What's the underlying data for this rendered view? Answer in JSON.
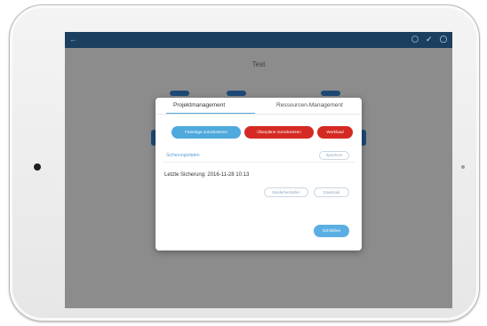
{
  "app": {
    "back_label": "←",
    "page_title": "Test"
  },
  "modal": {
    "tabs": [
      {
        "label": "Projektmanagement",
        "active": true
      },
      {
        "label": "Ressourcen-Management",
        "active": false
      }
    ],
    "actions": {
      "reset_blue": "Feiertage zurücksetzen",
      "reset_red": "Überpläne zurücksetzen",
      "workload": "Workload"
    },
    "section_label": "Sicherungsdaten",
    "save_label": "Speichern",
    "last_backup": "Letzte Sicherung: 2016-11-28 10:13",
    "restore_label": "Wiederherstellen",
    "download_label": "Download",
    "continue_label": "Schließen"
  },
  "colors": {
    "topbar": "#1a3f5f",
    "accent_blue": "#4fa9dd",
    "accent_red": "#d42a23",
    "screen_bg": "#8c8c8c"
  },
  "icons": {
    "topbar": [
      "globe-icon",
      "tool-icon",
      "user-icon"
    ]
  }
}
